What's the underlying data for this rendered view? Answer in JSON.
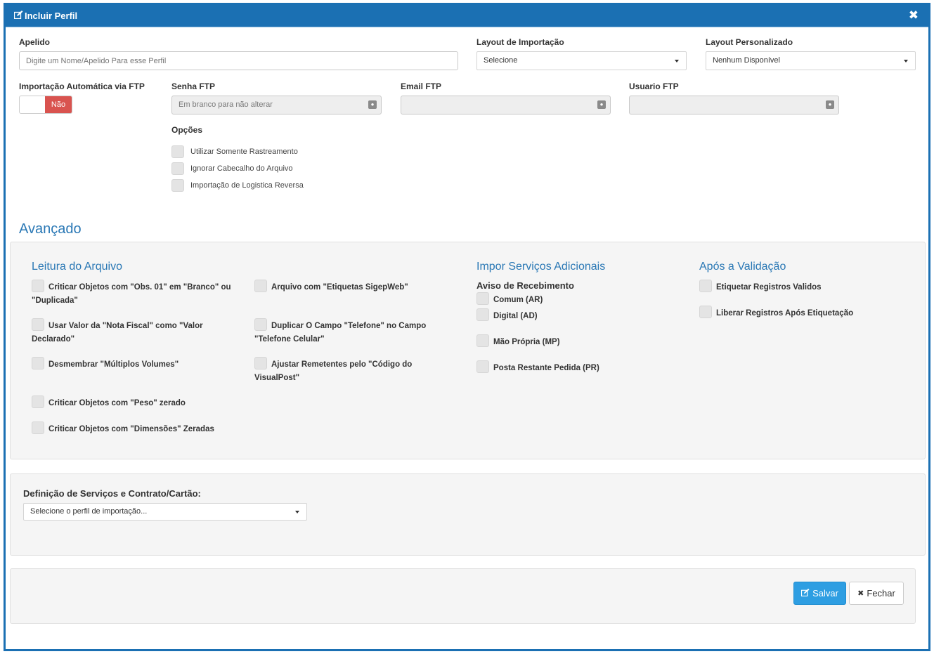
{
  "header": {
    "title": "Incluir Perfil",
    "title_icon": "edit-icon",
    "close_icon": "close-icon",
    "close_glyph": "✖"
  },
  "form": {
    "apelido": {
      "label": "Apelido",
      "placeholder": "Digite um Nome/Apelido Para esse Perfil",
      "value": ""
    },
    "layout_importacao": {
      "label": "Layout de Importação",
      "selected": "Selecione"
    },
    "layout_personalizado": {
      "label": "Layout Personalizado",
      "selected": "Nenhum Disponível"
    },
    "importacao_ftp": {
      "label": "Importação Automática via FTP",
      "toggle_off_label": "Não",
      "state": "off"
    },
    "senha_ftp": {
      "label": "Senha FTP",
      "placeholder": "Em branco para não alterar"
    },
    "email_ftp": {
      "label": "Email FTP",
      "value": ""
    },
    "usuario_ftp": {
      "label": "Usuario FTP",
      "value": ""
    },
    "opcoes": {
      "label": "Opções",
      "items": [
        "Utilizar Somente Rastreamento",
        "Ignorar Cabecalho do Arquivo",
        "Importação de Logistica Reversa"
      ]
    }
  },
  "avancado": {
    "title": "Avançado",
    "leitura": {
      "title": "Leitura do Arquivo",
      "col1": [
        "Criticar Objetos com \"Obs. 01\" em \"Branco\" ou \"Duplicada\"",
        "Usar Valor da \"Nota Fiscal\" como \"Valor Declarado\"",
        "Desmembrar \"Múltiplos Volumes\"",
        "Criticar Objetos com \"Peso\" zerado",
        "Criticar Objetos com \"Dimensões\" Zeradas"
      ],
      "col2": [
        "Arquivo com \"Etiquetas SigepWeb\"",
        "Duplicar O Campo \"Telefone\" no Campo \"Telefone Celular\"",
        "Ajustar Remetentes pelo \"Código do VisualPost\""
      ]
    },
    "servicos": {
      "title": "Impor Serviços Adicionais",
      "subtitle": "Aviso de Recebimento",
      "items": [
        "Comum (AR)",
        "Digital (AD)",
        "Mão Própria (MP)",
        "Posta Restante Pedida (PR)"
      ]
    },
    "validacao": {
      "title": "Após a Validação",
      "items": [
        "Etiquetar Registros Validos",
        "Liberar Registros Após Etiquetação"
      ]
    }
  },
  "definicao": {
    "label": "Definição de Serviços e Contrato/Cartão:",
    "selected": "Selecione o perfil de importação..."
  },
  "footer": {
    "save_label": "Salvar",
    "save_icon": "edit-icon",
    "close_label": "Fechar",
    "close_icon": "close-icon"
  },
  "colors": {
    "primary": "#1b70b3",
    "accent": "#2a78b5",
    "save": "#2e9ee2",
    "danger": "#d9534f"
  }
}
